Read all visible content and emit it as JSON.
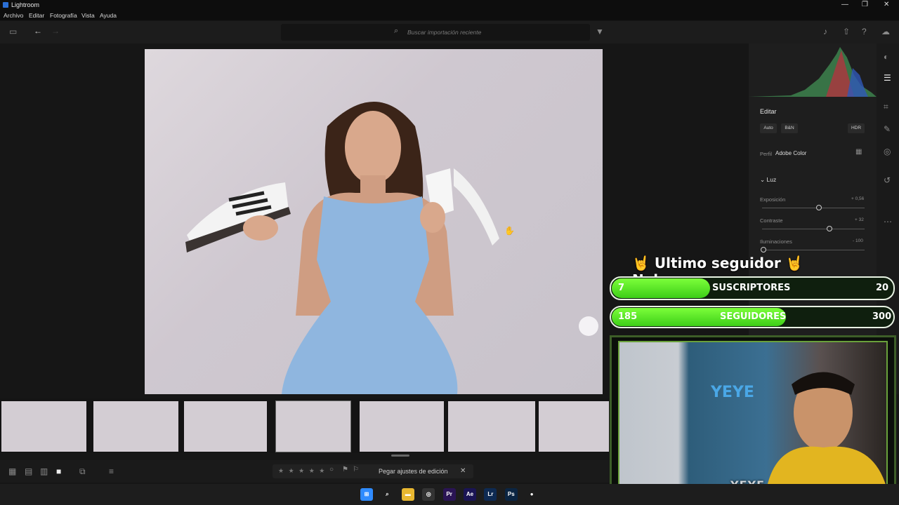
{
  "window": {
    "title": "Lightroom",
    "minimize": "—",
    "maximize": "❐",
    "close": "✕"
  },
  "menu": [
    "Archivo",
    "Editar",
    "Fotografía",
    "Vista",
    "Ayuda"
  ],
  "toolbar": {
    "search_placeholder": "Buscar importación reciente"
  },
  "edit_panel": {
    "title": "Editar",
    "buttons": [
      "Auto",
      "B&N",
      "HDR"
    ],
    "profile_label": "Perfil",
    "profile_value": "Adobe Color",
    "section": "Luz",
    "sliders": [
      {
        "label": "Exposición",
        "value": "+ 0,56",
        "level": 0.56
      },
      {
        "label": "Contraste",
        "value": "+ 32",
        "level": 0.66
      },
      {
        "label": "Iluminaciones",
        "value": "- 100",
        "level": 0.0
      }
    ]
  },
  "bottom": {
    "paste_label": "Pegar ajustes de edición",
    "stars": "★ ★ ★ ★ ★"
  },
  "stream": {
    "last_follower_prefix": "Ultimo seguidor",
    "last_follower_name": "Nahu_carug",
    "subs": {
      "label": "SUSCRIPTORES",
      "current": "7",
      "goal": "20",
      "progress": 0.35
    },
    "followers": {
      "label": "SEGUIDORES",
      "current": "185",
      "goal": "300",
      "progress": 0.62
    },
    "cam_brand": "YEYE"
  },
  "taskbar": [
    {
      "name": "start",
      "label": "⊞",
      "color": "#2f8bff"
    },
    {
      "name": "search",
      "label": "⌕",
      "color": "#1d1d1d"
    },
    {
      "name": "files",
      "label": "▬",
      "color": "#e8b730"
    },
    {
      "name": "browser-alt",
      "label": "◎",
      "color": "#333"
    },
    {
      "name": "premiere",
      "label": "Pr",
      "color": "#2a1454"
    },
    {
      "name": "after-effects",
      "label": "Ae",
      "color": "#1a1454"
    },
    {
      "name": "lightroom",
      "label": "Lr",
      "color": "#0e2a52"
    },
    {
      "name": "photoshop",
      "label": "Ps",
      "color": "#0b2542"
    },
    {
      "name": "chrome",
      "label": "●",
      "color": "#1d1d1d"
    }
  ],
  "colors": {
    "accent_green": "#4fe021",
    "lr_blue": "#2b6fd6"
  }
}
